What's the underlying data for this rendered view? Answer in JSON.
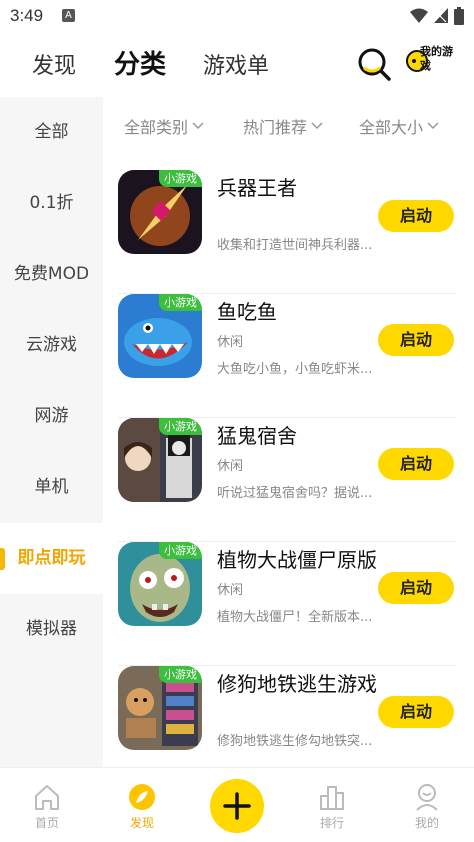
{
  "status_bar": {
    "time": "3:49",
    "app_icon_letter": "A"
  },
  "top_tabs": [
    {
      "label": "发现"
    },
    {
      "label": "分类"
    },
    {
      "label": "游戏单"
    }
  ],
  "my_games_label": "我的游戏",
  "sidebar": {
    "items": [
      {
        "label": "全部"
      },
      {
        "label": "0.1折"
      },
      {
        "label": "免费MOD"
      },
      {
        "label": "云游戏"
      },
      {
        "label": "网游"
      },
      {
        "label": "单机"
      },
      {
        "label": "即点即玩"
      },
      {
        "label": "模拟器"
      }
    ],
    "active_index": 6
  },
  "filters": [
    {
      "label": "全部类别"
    },
    {
      "label": "热门推荐"
    },
    {
      "label": "全部大小"
    }
  ],
  "games": [
    {
      "badge": "小游戏",
      "title": "兵器王者",
      "tag": "",
      "desc": "收集和打造世间神兵利器...",
      "button": "启动"
    },
    {
      "badge": "小游戏",
      "title": "鱼吃鱼",
      "tag": "休闲",
      "desc": "大鱼吃小鱼，小鱼吃虾米...",
      "button": "启动"
    },
    {
      "badge": "小游戏",
      "title": "猛鬼宿舍",
      "tag": "休闲",
      "desc": "听说过猛鬼宿舍吗？据说...",
      "button": "启动"
    },
    {
      "badge": "小游戏",
      "title": "植物大战僵尸原版",
      "tag": "休闲",
      "desc": "植物大战僵尸！全新版本...",
      "button": "启动"
    },
    {
      "badge": "小游戏",
      "title": "修狗地铁逃生游戏",
      "tag": "",
      "desc": "修狗地铁逃生修勾地铁突...",
      "button": "启动"
    }
  ],
  "bottom_nav": [
    {
      "label": "首页"
    },
    {
      "label": "发现"
    },
    {
      "label": "排行"
    },
    {
      "label": "我的"
    }
  ],
  "colors": {
    "accent": "#ffd800",
    "active_text": "#f3a600",
    "badge_green": "#3cbf3c"
  }
}
